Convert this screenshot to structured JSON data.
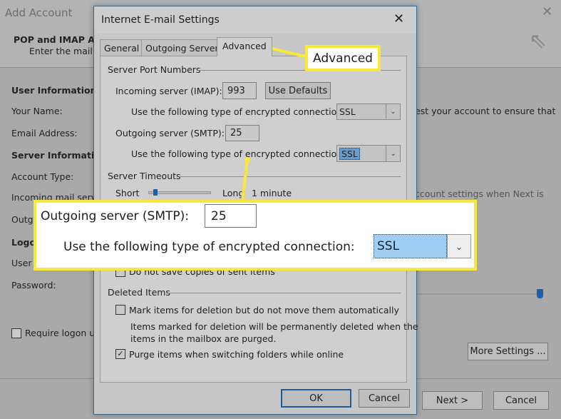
{
  "background_window": {
    "title": "Add Account",
    "header_title": "POP and IMAP Ac",
    "header_subtitle": "Enter the mail s",
    "user_information": "User Information",
    "your_name": "Your Name:",
    "email_address": "Email Address:",
    "server_information": "Server Information",
    "account_type": "Account Type:",
    "incoming_mail_server": "Incoming mail serve",
    "outgoing_partial": "Outg",
    "logon_partial": "Logo",
    "user_partial": "User",
    "password": "Password:",
    "require_logon": "Require logon us",
    "test_text": "est your account to ensure that",
    "test_settings_text": "ccount settings when Next is",
    "more_settings": "More Settings ...",
    "next": "Next >",
    "cancel": "Cancel",
    "close_icon": "close-icon",
    "wizard_icon": "cursor-click-icon"
  },
  "dialog": {
    "title": "Internet E-mail Settings",
    "tabs": [
      {
        "label": "General",
        "active": false
      },
      {
        "label": "Outgoing Server",
        "active": false
      },
      {
        "label": "Advanced",
        "active": true
      }
    ],
    "server_port_numbers": "Server Port Numbers",
    "incoming_label": "Incoming server (IMAP):",
    "incoming_value": "993",
    "use_defaults": "Use Defaults",
    "encryption_label": "Use the following type of encrypted connection:",
    "incoming_encryption": "SSL",
    "outgoing_label": "Outgoing server (SMTP):",
    "outgoing_value": "25",
    "outgoing_encryption": "SSL",
    "server_timeouts": "Server Timeouts",
    "short": "Short",
    "long": "Long",
    "timeout_value": "1 minute",
    "timeout_level": 0.1,
    "do_not_save": "Do not save copies of sent items",
    "deleted_items": "Deleted Items",
    "mark_items": "Mark items for deletion but do not move them automatically",
    "mark_items_checked": false,
    "mark_note_1": "Items marked for deletion will be permanently deleted when the",
    "mark_note_2": "items in the mailbox are purged.",
    "purge_items": "Purge items when switching folders while online",
    "purge_items_checked": true,
    "ok": "OK",
    "cancel": "Cancel"
  },
  "annotations": {
    "advanced_callout": "Advanced",
    "zoom_outgoing_label": "Outgoing server (SMTP):",
    "zoom_outgoing_value": "25",
    "zoom_encryption_label": "Use the following type of encrypted connection:",
    "zoom_encryption_value": "SSL",
    "highlight_color": "#f6e93a",
    "selection_color": "#9fcff5"
  }
}
